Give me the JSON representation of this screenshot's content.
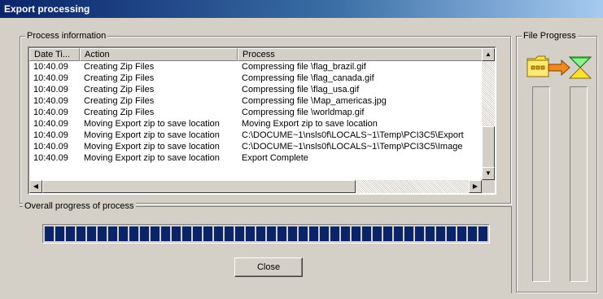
{
  "window": {
    "title": "Export processing"
  },
  "process_info": {
    "legend": "Process information",
    "columns": [
      "Date Ti...",
      "Action",
      "Process"
    ],
    "rows": [
      {
        "time": "10:40.09",
        "action": "Creating Zip Files",
        "process": "Compressing file \\flag_brazil.gif"
      },
      {
        "time": "10:40.09",
        "action": "Creating Zip Files",
        "process": "Compressing file \\flag_canada.gif"
      },
      {
        "time": "10:40.09",
        "action": "Creating Zip Files",
        "process": "Compressing file \\flag_usa.gif"
      },
      {
        "time": "10:40.09",
        "action": "Creating Zip Files",
        "process": "Compressing file \\Map_americas.jpg"
      },
      {
        "time": "10:40.09",
        "action": "Creating Zip Files",
        "process": "Compressing file \\worldmap.gif"
      },
      {
        "time": "10:40.09",
        "action": "Moving Export zip to save location",
        "process": "Moving Export zip to save location"
      },
      {
        "time": "10:40.09",
        "action": "Moving Export zip to save location",
        "process": "C:\\DOCUME~1\\nsls0f\\LOCALS~1\\Temp\\PCI3C5\\Export"
      },
      {
        "time": "10:40.09",
        "action": "Moving Export zip to save location",
        "process": "C:\\DOCUME~1\\nsls0f\\LOCALS~1\\Temp\\PCI3C5\\Image"
      },
      {
        "time": "10:40.09",
        "action": "Moving Export zip to save location",
        "process": "Export Complete"
      }
    ]
  },
  "overall_progress": {
    "legend": "Overall progress of process",
    "percent": 100
  },
  "close_button": {
    "label": "Close"
  },
  "file_progress": {
    "legend": "File Progress",
    "left_bar_percent": 0,
    "right_bar_percent": 0
  },
  "icons": {
    "file_transfer": "folder-to-zip-arrow-icon"
  },
  "colors": {
    "title_start": "#0a246a",
    "title_end": "#a6caf0",
    "progress": "#0a246a",
    "face": "#d4d0c8"
  }
}
